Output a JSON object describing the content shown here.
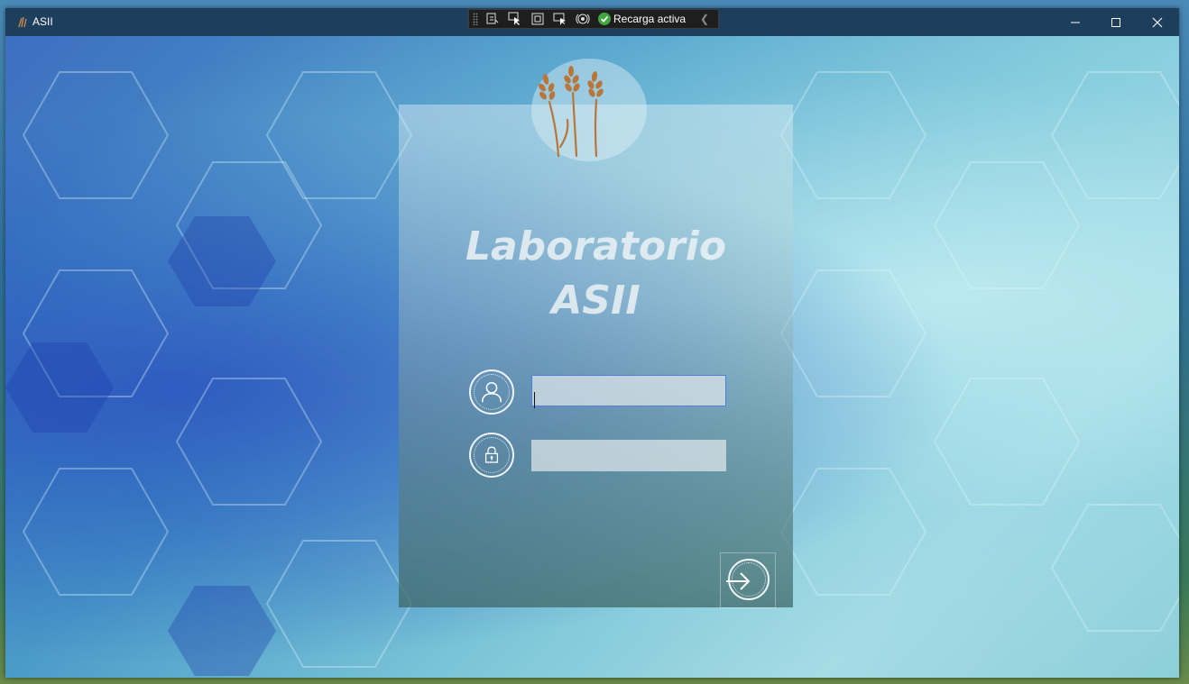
{
  "window": {
    "title": "ASII",
    "icon": "wheat-icon",
    "controls": [
      "minimize",
      "maximize",
      "close"
    ]
  },
  "debug_toolbar": {
    "icons": [
      "live-visual-tree-icon",
      "select-element-icon",
      "display-layout-adorners-icon",
      "track-focus-icon",
      "accessibility-check-icon"
    ],
    "reload_status": "Recarga activa",
    "collapse_icon": "chevron-left-icon"
  },
  "login": {
    "logo": "wheat-logo",
    "title_line1": "Laboratorio",
    "title_line2": "ASII",
    "username": {
      "icon": "user-icon",
      "value": "",
      "placeholder": ""
    },
    "password": {
      "icon": "lock-icon",
      "value": "",
      "placeholder": ""
    },
    "submit_icon": "login-arrow-icon"
  },
  "colors": {
    "titlebar": "#1d3e5c",
    "title_text": "#ebf2f5",
    "focus_border": "#4f7fd8",
    "logo_wheat": "#b8763a"
  }
}
